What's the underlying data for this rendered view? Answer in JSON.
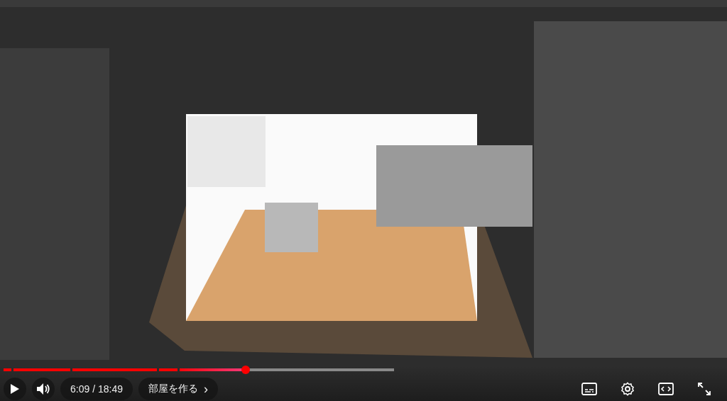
{
  "player": {
    "progress": {
      "level": 0.62
    },
    "time": "6:09 / 18:49",
    "chapter": {
      "title": "部屋を作る",
      "arrow": "›"
    }
  }
}
